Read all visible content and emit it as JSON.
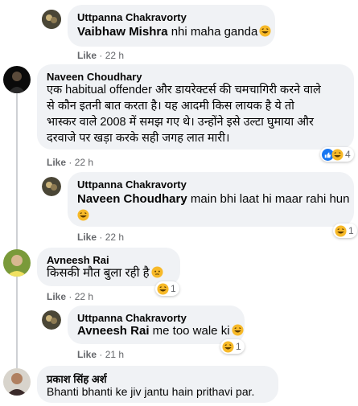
{
  "comments": [
    {
      "name": "Uttpanna Chakravorty",
      "mention": "Vaibhaw Mishra",
      "text": " nhi maha ganda",
      "like": "Like",
      "time": "22 h"
    },
    {
      "name": "Naveen Choudhary",
      "lines": [
        "एक habitual offender और डायरेक्टर्स की चमचागिरी करने वाले",
        "से कौन इतनी बात करता है। यह आदमी किस लायक है ये तो",
        "भास्कर वाले 2008 में समझ गए थे। उन्होंने इसे उल्टा घुमाया और",
        "दरवाजे पर खड़ा करके सही जगह लात मारी।"
      ],
      "like": "Like",
      "time": "22 h",
      "reaction_count": "4"
    },
    {
      "name": "Uttpanna Chakravorty",
      "mention": "Naveen Choudhary",
      "text": " main bhi laat hi maar rahi hun",
      "like": "Like",
      "time": "22 h",
      "reaction_count": "1"
    },
    {
      "name": "Avneesh Rai",
      "text": "किसकी मौत बुला रही है",
      "like": "Like",
      "time": "22 h",
      "reaction_count": "1"
    },
    {
      "name": "Uttpanna Chakravorty",
      "mention": "Avneesh Rai",
      "text": " me too wale ki",
      "like": "Like",
      "time": "21 h",
      "reaction_count": "1"
    },
    {
      "name": "प्रकाश सिंह अर्श",
      "text": "Bhanti bhanti ke jiv jantu hain prithavi par."
    }
  ],
  "meta_separator": "·",
  "colors": {
    "bubble": "#f0f2f5",
    "meta": "#65676b",
    "like_blue": "#1877f2",
    "haha_yellow": "#f7b928"
  }
}
